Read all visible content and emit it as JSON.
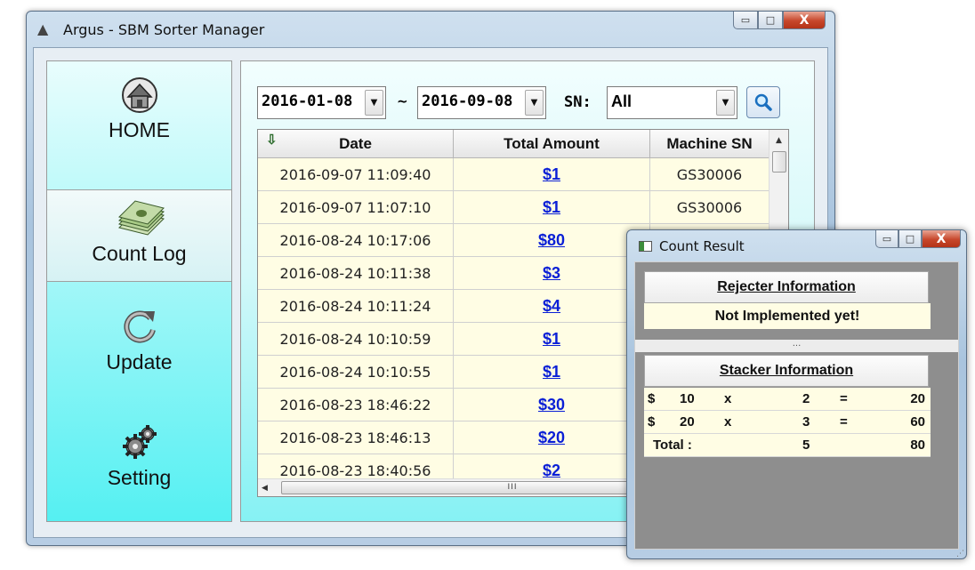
{
  "main_window": {
    "title": "Argus - SBM Sorter Manager",
    "caption": {
      "minimize": "▭",
      "maximize": "□",
      "close": "X"
    }
  },
  "nav": {
    "items": [
      {
        "label": "HOME",
        "icon": "home-icon"
      },
      {
        "label": "Count Log",
        "icon": "money-stack-icon",
        "active": true
      },
      {
        "label": "Update",
        "icon": "refresh-icon"
      },
      {
        "label": "Setting",
        "icon": "gears-icon"
      }
    ]
  },
  "filter": {
    "date_from": "2016-01-08",
    "separator": "~",
    "date_to": "2016-09-08",
    "sn_label": "SN:",
    "sn_value": "All"
  },
  "grid": {
    "columns": [
      "Date",
      "Total Amount",
      "Machine SN"
    ],
    "rows": [
      {
        "date": "2016-09-07 11:09:40",
        "amount": "$1",
        "sn": "GS30006"
      },
      {
        "date": "2016-09-07 11:07:10",
        "amount": "$1",
        "sn": "GS30006"
      },
      {
        "date": "2016-08-24 10:17:06",
        "amount": "$80",
        "sn": ""
      },
      {
        "date": "2016-08-24 10:11:38",
        "amount": "$3",
        "sn": ""
      },
      {
        "date": "2016-08-24 10:11:24",
        "amount": "$4",
        "sn": ""
      },
      {
        "date": "2016-08-24 10:10:59",
        "amount": "$1",
        "sn": ""
      },
      {
        "date": "2016-08-24 10:10:55",
        "amount": "$1",
        "sn": ""
      },
      {
        "date": "2016-08-23 18:46:22",
        "amount": "$30",
        "sn": ""
      },
      {
        "date": "2016-08-23 18:46:13",
        "amount": "$20",
        "sn": ""
      },
      {
        "date": "2016-08-23 18:40:56",
        "amount": "$2",
        "sn": ""
      }
    ],
    "hscroll_grip": "III"
  },
  "dialog": {
    "title": "Count Result",
    "rejecter_title": "Rejecter Information",
    "rejecter_message": "Not Implemented yet!",
    "splitter_grip": "...",
    "stacker_title": "Stacker Information",
    "stacker_rows": [
      {
        "currency": "$",
        "denom": "10",
        "op": "x",
        "count": "2",
        "eq": "=",
        "total": "20"
      },
      {
        "currency": "$",
        "denom": "20",
        "op": "x",
        "count": "3",
        "eq": "=",
        "total": "60"
      }
    ],
    "total_label": "Total :",
    "total_count": "5",
    "total_amount": "80"
  }
}
